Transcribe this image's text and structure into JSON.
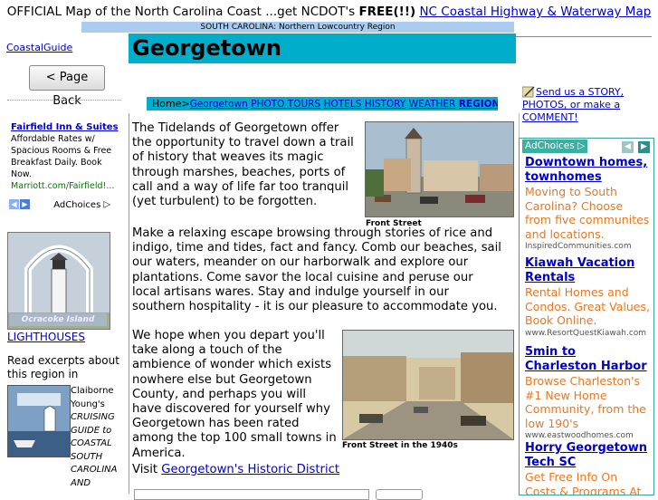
{
  "banner": {
    "prefix": "OFFICIAL Map of the North Carolina Coast ...get NCDOT's ",
    "free": "FREE(!!)",
    "link": "NC Coastal Highway & Waterway Map"
  },
  "region_bar": "SOUTH CAROLINA: Northern Lowcountry Region",
  "left": {
    "coastal_link": "CoastalGuide",
    "back_button": "< Page Back",
    "ad": {
      "title": "Fairfield Inn & Suites",
      "body": "Affordable Rates w/ Spacious Rooms & Free Breakfast Daily. Book Now.",
      "url": "Marriott.com/Fairfield!..."
    },
    "adchoices": "AdChoices",
    "lighthouse_caption": "Ocracoke Island",
    "lighthouses_link": "LIGHTHOUSES",
    "excerpt_intro": "Read excerpts about this region in",
    "book_text_1": "Claiborne Young's",
    "book_text_2": "CRUISING GUIDE to COASTAL SOUTH CAROLINA AND"
  },
  "page": {
    "title": "Georgetown",
    "nav_prefix": "Home>",
    "nav_items": [
      "Georgetown",
      "PHOTO TOURS",
      "HOTELS",
      "HISTORY",
      "WEATHER",
      "REGION"
    ],
    "para1": "The Tidelands of Georgetown offer the opportunity to travel down a trail of history that weaves its magic through marshes, beaches, ports of call and a way of life far too tranquil (yet turbulent) to be forgotten.",
    "para2": "Make a relaxing escape browsing through stories of rice and indigo, time and tides, fact and fancy. Comb our beaches, sail our waters, meander on our harborwalk and explore our plantations. Come savor the local cuisine and peruse our local artisans wares. Stay and indulge yourself in our southern hospitality - it is our pleasure to accommodate you.",
    "para3": "We hope when you depart you'll take along a touch of the ambience of wonder which exists nowhere else but Georgetown County, and perhaps you will have discovered for yourself why Georgetown has been rated among the top 100 small towns in America.",
    "visit_prefix": "Visit ",
    "visit_link": "Georgetown's Historic District",
    "photo1_caption": "Front Street",
    "photo2_caption": "Front Street in the 1940s"
  },
  "right": {
    "send_story": "Send us a STORY, PHOTOS, or make a COMMENT!",
    "adchoices": "AdChoices",
    "ads": [
      {
        "title": "Downtown homes, townhomes",
        "body": "Moving to South Carolina? Choose from five communites and locations.",
        "url": "InspiredCommunities.com"
      },
      {
        "title": "Kiawah Vacation Rentals",
        "body": "Rental Homes and Condos. Great Values, Book Online.",
        "url": "www.ResortQuestKiawah.com"
      },
      {
        "title": "5min to Charleston Harbor",
        "body": "Browse Charleston's #1 New Home Community, from the low 190's",
        "url": "www.eastwoodhomes.com"
      },
      {
        "title": "Horry Georgetown Tech SC",
        "body": "Get Free Info On Costs & Programs At Horry",
        "url": ""
      }
    ]
  },
  "colors": {
    "accent": "#00aecb",
    "link": "#0000cc",
    "ad_body": "#e87722"
  }
}
